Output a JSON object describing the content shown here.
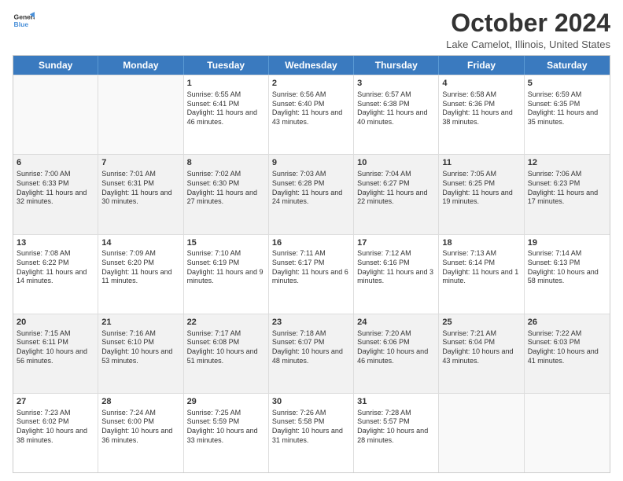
{
  "logo": {
    "line1": "General",
    "line2": "Blue"
  },
  "title": "October 2024",
  "subtitle": "Lake Camelot, Illinois, United States",
  "days_of_week": [
    "Sunday",
    "Monday",
    "Tuesday",
    "Wednesday",
    "Thursday",
    "Friday",
    "Saturday"
  ],
  "rows": [
    [
      {
        "day": "",
        "empty": true
      },
      {
        "day": "",
        "empty": true
      },
      {
        "day": "1",
        "sunrise": "Sunrise: 6:55 AM",
        "sunset": "Sunset: 6:41 PM",
        "daylight": "Daylight: 11 hours and 46 minutes."
      },
      {
        "day": "2",
        "sunrise": "Sunrise: 6:56 AM",
        "sunset": "Sunset: 6:40 PM",
        "daylight": "Daylight: 11 hours and 43 minutes."
      },
      {
        "day": "3",
        "sunrise": "Sunrise: 6:57 AM",
        "sunset": "Sunset: 6:38 PM",
        "daylight": "Daylight: 11 hours and 40 minutes."
      },
      {
        "day": "4",
        "sunrise": "Sunrise: 6:58 AM",
        "sunset": "Sunset: 6:36 PM",
        "daylight": "Daylight: 11 hours and 38 minutes."
      },
      {
        "day": "5",
        "sunrise": "Sunrise: 6:59 AM",
        "sunset": "Sunset: 6:35 PM",
        "daylight": "Daylight: 11 hours and 35 minutes."
      }
    ],
    [
      {
        "day": "6",
        "sunrise": "Sunrise: 7:00 AM",
        "sunset": "Sunset: 6:33 PM",
        "daylight": "Daylight: 11 hours and 32 minutes."
      },
      {
        "day": "7",
        "sunrise": "Sunrise: 7:01 AM",
        "sunset": "Sunset: 6:31 PM",
        "daylight": "Daylight: 11 hours and 30 minutes."
      },
      {
        "day": "8",
        "sunrise": "Sunrise: 7:02 AM",
        "sunset": "Sunset: 6:30 PM",
        "daylight": "Daylight: 11 hours and 27 minutes."
      },
      {
        "day": "9",
        "sunrise": "Sunrise: 7:03 AM",
        "sunset": "Sunset: 6:28 PM",
        "daylight": "Daylight: 11 hours and 24 minutes."
      },
      {
        "day": "10",
        "sunrise": "Sunrise: 7:04 AM",
        "sunset": "Sunset: 6:27 PM",
        "daylight": "Daylight: 11 hours and 22 minutes."
      },
      {
        "day": "11",
        "sunrise": "Sunrise: 7:05 AM",
        "sunset": "Sunset: 6:25 PM",
        "daylight": "Daylight: 11 hours and 19 minutes."
      },
      {
        "day": "12",
        "sunrise": "Sunrise: 7:06 AM",
        "sunset": "Sunset: 6:23 PM",
        "daylight": "Daylight: 11 hours and 17 minutes."
      }
    ],
    [
      {
        "day": "13",
        "sunrise": "Sunrise: 7:08 AM",
        "sunset": "Sunset: 6:22 PM",
        "daylight": "Daylight: 11 hours and 14 minutes."
      },
      {
        "day": "14",
        "sunrise": "Sunrise: 7:09 AM",
        "sunset": "Sunset: 6:20 PM",
        "daylight": "Daylight: 11 hours and 11 minutes."
      },
      {
        "day": "15",
        "sunrise": "Sunrise: 7:10 AM",
        "sunset": "Sunset: 6:19 PM",
        "daylight": "Daylight: 11 hours and 9 minutes."
      },
      {
        "day": "16",
        "sunrise": "Sunrise: 7:11 AM",
        "sunset": "Sunset: 6:17 PM",
        "daylight": "Daylight: 11 hours and 6 minutes."
      },
      {
        "day": "17",
        "sunrise": "Sunrise: 7:12 AM",
        "sunset": "Sunset: 6:16 PM",
        "daylight": "Daylight: 11 hours and 3 minutes."
      },
      {
        "day": "18",
        "sunrise": "Sunrise: 7:13 AM",
        "sunset": "Sunset: 6:14 PM",
        "daylight": "Daylight: 11 hours and 1 minute."
      },
      {
        "day": "19",
        "sunrise": "Sunrise: 7:14 AM",
        "sunset": "Sunset: 6:13 PM",
        "daylight": "Daylight: 10 hours and 58 minutes."
      }
    ],
    [
      {
        "day": "20",
        "sunrise": "Sunrise: 7:15 AM",
        "sunset": "Sunset: 6:11 PM",
        "daylight": "Daylight: 10 hours and 56 minutes."
      },
      {
        "day": "21",
        "sunrise": "Sunrise: 7:16 AM",
        "sunset": "Sunset: 6:10 PM",
        "daylight": "Daylight: 10 hours and 53 minutes."
      },
      {
        "day": "22",
        "sunrise": "Sunrise: 7:17 AM",
        "sunset": "Sunset: 6:08 PM",
        "daylight": "Daylight: 10 hours and 51 minutes."
      },
      {
        "day": "23",
        "sunrise": "Sunrise: 7:18 AM",
        "sunset": "Sunset: 6:07 PM",
        "daylight": "Daylight: 10 hours and 48 minutes."
      },
      {
        "day": "24",
        "sunrise": "Sunrise: 7:20 AM",
        "sunset": "Sunset: 6:06 PM",
        "daylight": "Daylight: 10 hours and 46 minutes."
      },
      {
        "day": "25",
        "sunrise": "Sunrise: 7:21 AM",
        "sunset": "Sunset: 6:04 PM",
        "daylight": "Daylight: 10 hours and 43 minutes."
      },
      {
        "day": "26",
        "sunrise": "Sunrise: 7:22 AM",
        "sunset": "Sunset: 6:03 PM",
        "daylight": "Daylight: 10 hours and 41 minutes."
      }
    ],
    [
      {
        "day": "27",
        "sunrise": "Sunrise: 7:23 AM",
        "sunset": "Sunset: 6:02 PM",
        "daylight": "Daylight: 10 hours and 38 minutes."
      },
      {
        "day": "28",
        "sunrise": "Sunrise: 7:24 AM",
        "sunset": "Sunset: 6:00 PM",
        "daylight": "Daylight: 10 hours and 36 minutes."
      },
      {
        "day": "29",
        "sunrise": "Sunrise: 7:25 AM",
        "sunset": "Sunset: 5:59 PM",
        "daylight": "Daylight: 10 hours and 33 minutes."
      },
      {
        "day": "30",
        "sunrise": "Sunrise: 7:26 AM",
        "sunset": "Sunset: 5:58 PM",
        "daylight": "Daylight: 10 hours and 31 minutes."
      },
      {
        "day": "31",
        "sunrise": "Sunrise: 7:28 AM",
        "sunset": "Sunset: 5:57 PM",
        "daylight": "Daylight: 10 hours and 28 minutes."
      },
      {
        "day": "",
        "empty": true
      },
      {
        "day": "",
        "empty": true
      }
    ]
  ]
}
